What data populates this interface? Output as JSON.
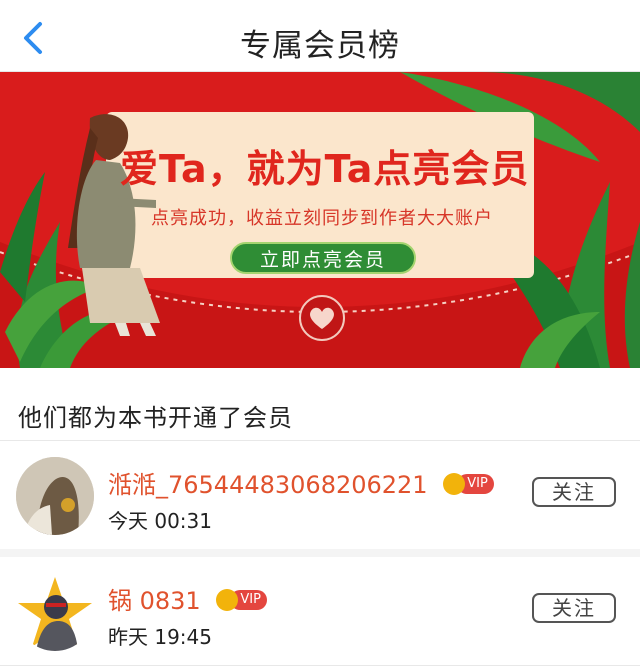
{
  "header": {
    "title": "专属会员榜",
    "back_icon": "chevron-left-icon",
    "accent_color": "#2d8cf0"
  },
  "banner": {
    "headline": "爱Ta，就为Ta点亮会员",
    "subtitle": "点亮成功，收益立刻同步到作者大大账户",
    "cta_label": "立即点亮会员",
    "colors": {
      "background": "#d91c1c",
      "card": "#fbe6cc",
      "cta": "#2f8d35"
    }
  },
  "section": {
    "title": "他们都为本书开通了会员"
  },
  "members": [
    {
      "name": "湉湉_76544483068206221",
      "badge": "VIP",
      "time": "今天 00:31",
      "follow_label": "关注"
    },
    {
      "name": "锅 0831",
      "badge": "VIP",
      "time": "昨天 19:45",
      "follow_label": "关注"
    }
  ]
}
